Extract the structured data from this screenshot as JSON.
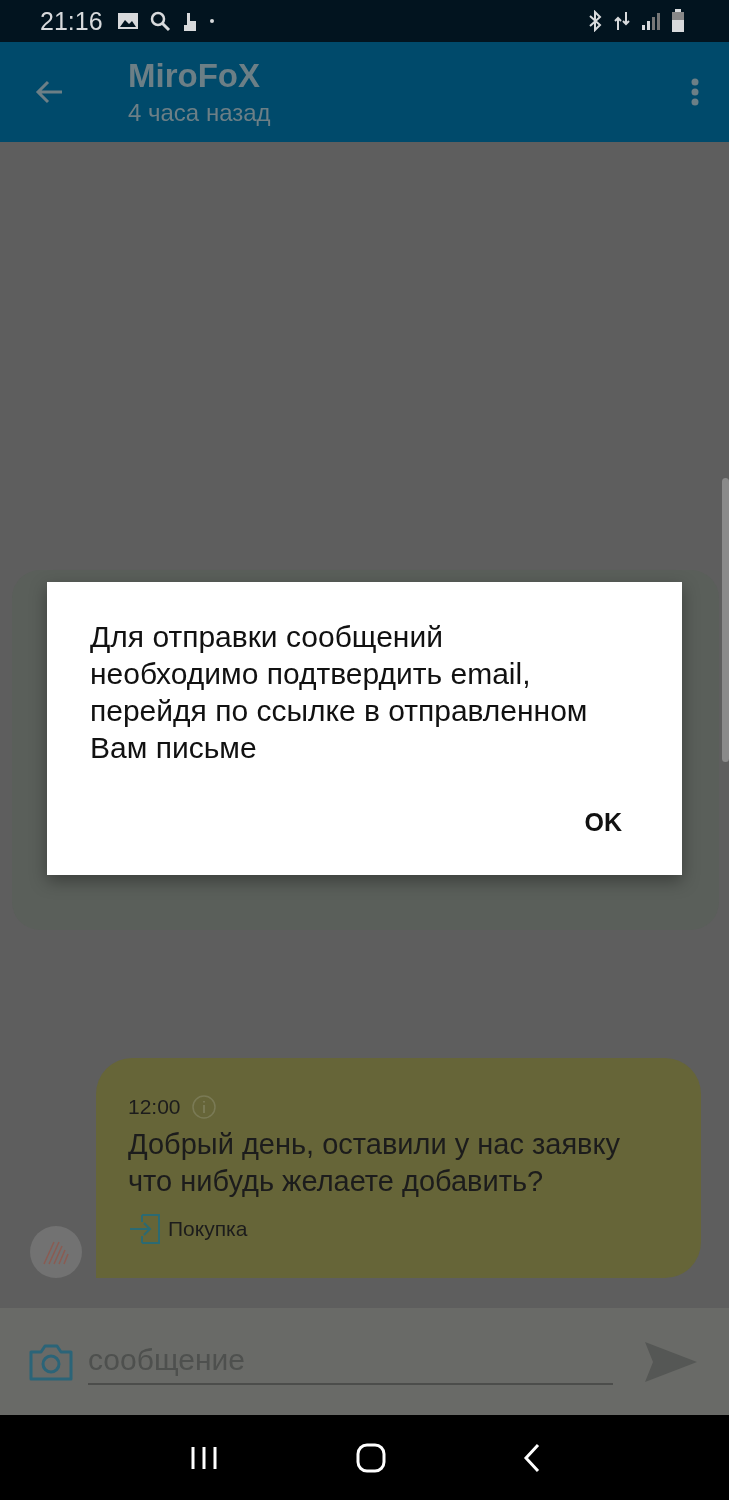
{
  "status_bar": {
    "time": "21:16"
  },
  "header": {
    "title": "MiroFoX",
    "subtitle": "4 часа назад"
  },
  "messages": [
    {
      "time": "12:00",
      "text": "Добрый день, оставили у нас заявку что нибудь желаете добавить?",
      "tag": "Покупка"
    }
  ],
  "composer": {
    "placeholder": "сообщение"
  },
  "dialog": {
    "message": "Для отправки сообщений необходимо подтвердить email, перейдя по ссылке в отправленном Вам письме",
    "buttons": [
      "OK"
    ]
  }
}
